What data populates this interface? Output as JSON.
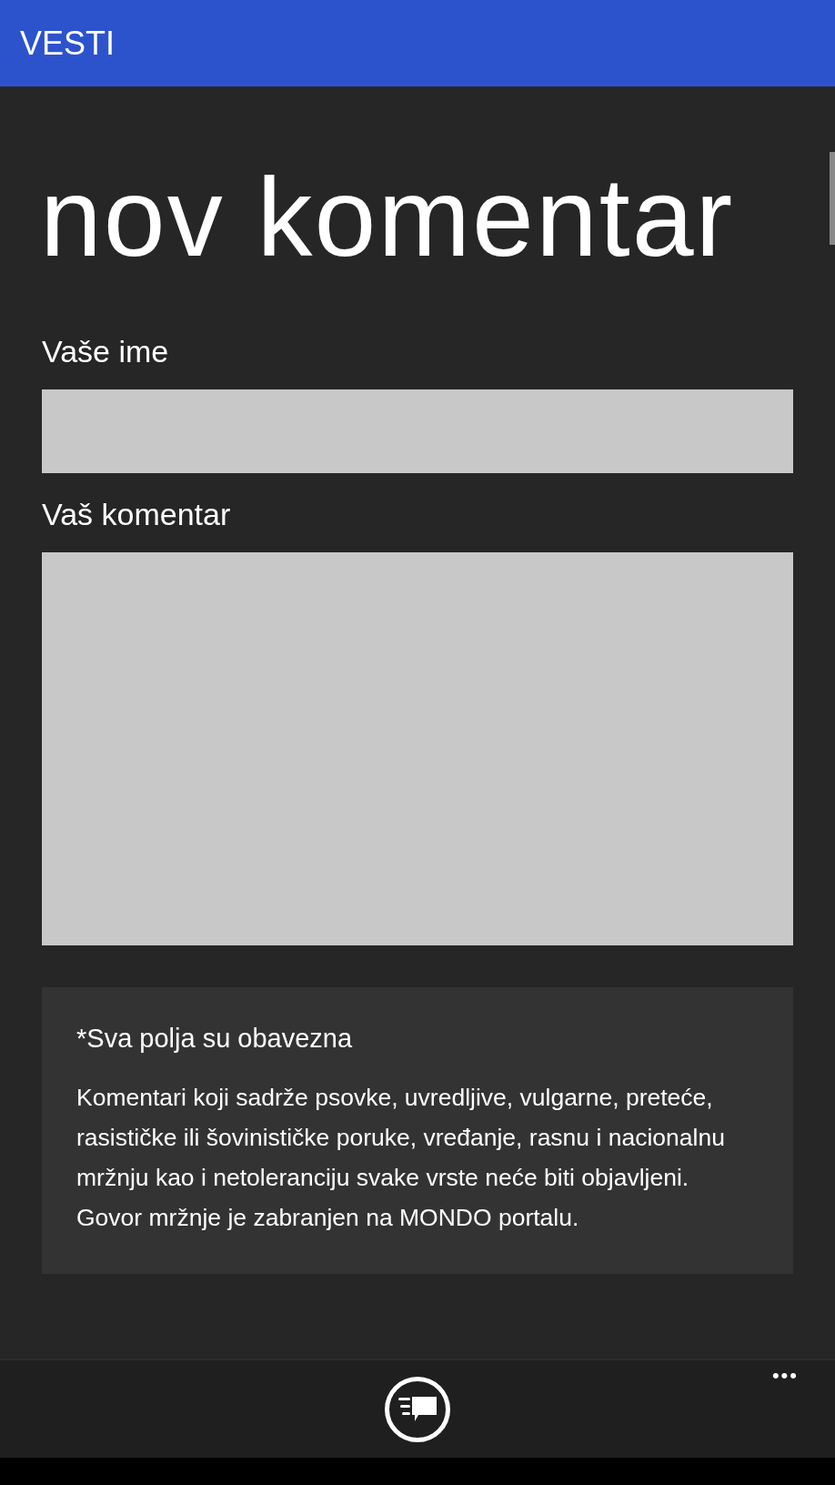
{
  "header": {
    "title": "VESTI"
  },
  "page_title": "nov komentar",
  "form": {
    "fields": [
      {
        "label": "Vaše ime",
        "kind": "single"
      },
      {
        "label": "Vaš komentar",
        "kind": "multi"
      }
    ]
  },
  "notice": {
    "title": "*Sva polja su obavezna",
    "text": "Komentari koji sadrže psovke, uvredljive, vulgarne, preteće, rasističke ili šovinističke poruke, vređanje, rasnu i nacionalnu mržnju kao i netoleranciju svake vrste neće biti objavljeni. Govor mržnje je zabranjen na MONDO portalu."
  },
  "app_bar": {
    "buttons": [
      {
        "kind": "comment"
      }
    ],
    "more": "•••"
  }
}
